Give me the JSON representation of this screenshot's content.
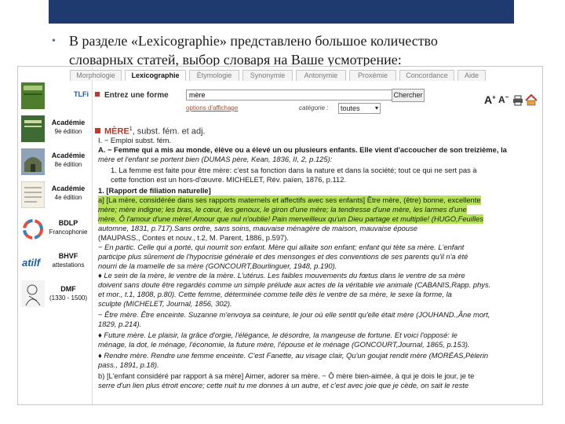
{
  "slide": {
    "bullet_line1": "В разделе «Lexicographie» представлено большое количество",
    "bullet_line2": "словарных статей, выбор словаря на Ваше усмотрение:"
  },
  "tabs": [
    {
      "label": "Morphologie"
    },
    {
      "label": "Lexicographie"
    },
    {
      "label": "Étymologie"
    },
    {
      "label": "Synonymie"
    },
    {
      "label": "Antonymie"
    },
    {
      "label": "Proxémie"
    },
    {
      "label": "Concordance"
    },
    {
      "label": "Aide"
    }
  ],
  "sidebar": [
    {
      "label": "TLFi",
      "sub": ""
    },
    {
      "label": "Académie",
      "sub": "9e édition"
    },
    {
      "label": "Académie",
      "sub": "8e édition"
    },
    {
      "label": "Académie",
      "sub": "4e édition"
    },
    {
      "label": "BDLP",
      "sub": "Francophonie"
    },
    {
      "label": "BHVF",
      "sub": "attestations"
    },
    {
      "label": "DMF",
      "sub": "(1330 - 1500)"
    }
  ],
  "search": {
    "entree_label": "Entrez une forme",
    "value": "mère",
    "button_label": "Chercher",
    "options_link": "options d'affichage",
    "categorie_label": "catégorie :",
    "categorie_value": "toutes"
  },
  "tools": {
    "font_up": "A",
    "font_down": "A",
    "print": "print",
    "home": "home"
  },
  "article": {
    "headword": "MÈRE",
    "homograph": "1",
    "gram": ", subst. fém. et adj.",
    "lines": [
      "I. − Emploi subst. fém.",
      "A. − Femme qui a mis au monde, élève ou a élevé un ou plusieurs enfants. Elle vient d'accoucher de son treizième, la",
      "mère et l'enfant se portent bien (DUMAS père, Kean, 1836, II, 2, p.125):",
      "1. La femme est faite pour être mère: c'est sa fonction dans la nature et dans la société; tout ce qui ne sert pas à",
      "cette fonction est un hors-d'œuvre. MICHELET, Rév. païen, 1876, p.112.",
      "1. [Rapport de filiation naturelle]",
      "a] [La mère, considérée dans ses rapports maternels et affectifs avec ses enfants] Être mère, (être) bonne, excellente",
      "mère; mère indigne; les bras, le cœur, les genoux, le giron d'une mère; la tendresse d'une mère, les larmes d'une",
      "mère. Ô l'amour d'une mère! Amour que nul n'oublie! Pain merveilleux qu'un Dieu partage et multiplie! (HUGO,Feuilles",
      "automne, 1831, p.717).Sans ordre, sans soins, mauvaise ménagère de maison, mauvaise épouse",
      "(MAUPASS., Contes et nouv., t.2, M. Parent, 1886, p.597).",
      "− En partic. Celle qui a porté, qui nourrit son enfant. Mère qui allaite son enfant; enfant qui tète sa mère. L'enfant",
      "participe plus sûrement de l'hypocrisie générale et des mensonges et des conventions de ses parents qu'il n'a été",
      "nourri de la mamelle de sa mère (GONCOURT,Bourlinguer, 1948, p.190).",
      "♦ Le sein de la mère, le ventre de la mère. L'utérus. Les faibles mouvements du fœtus dans le ventre de sa mère",
      "doivent sans doute être regardés comme un simple prélude aux actes de la véritable vie animale (CABANIS,Rapp. phys.",
      "et mor., t.1, 1808, p.80). Cette femme, déterminée comme telle dès le ventre de sa mère, le sexe la forme, la",
      "sculpte (MICHELET, Journal, 1856, 302).",
      "− Être mère. Être enceinte. Suzanne m'envoya sa ceinture, le jour où elle sentit qu'elle était mère (JOUHAND.,Âne mort,",
      "1829, p.214).",
      "♦ Future mère. Le plaisir, la grâce d'orgie, l'élégance, le désordre, la mangeuse de fortune. Et voici l'opposé: le",
      "ménage, la dot, le ménage, l'économie, la future mère, l'épouse et le ménage (GONCOURT,Journal, 1865, p.153).",
      "♦ Rendre mère. Rendre une femme enceinte. C'est Fanette, au visage clair, Qu'un goujat rendit mère (MORÉAS,Pèlerin",
      "pass., 1891, p.18).",
      "b) [L'enfant considéré par rapport à sa mère] Aimer, adorer sa mère. − Ô mère bien-aimée, à qui je dois le jour, je te",
      "serre d'un lien plus étroit encore; cette nuit tu me donnes à un autre, et c'est avec joie que je cède, on sait le reste"
    ]
  }
}
